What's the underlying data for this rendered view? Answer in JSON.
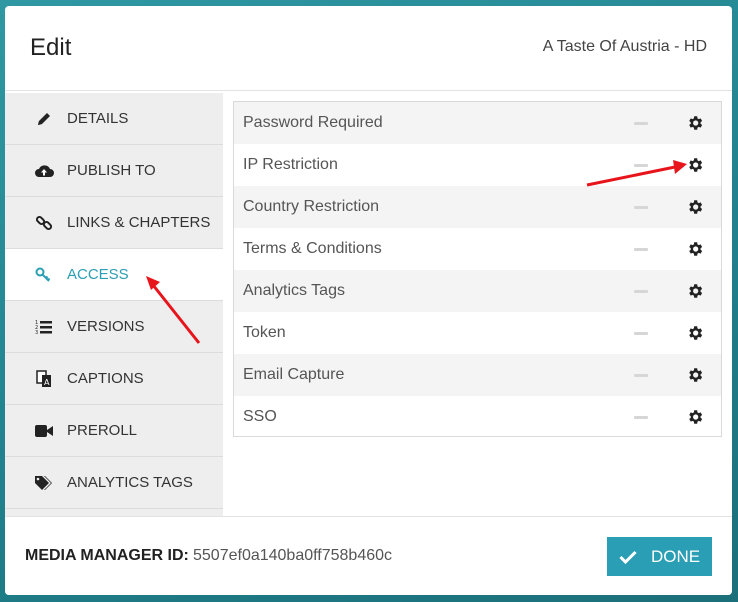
{
  "modal": {
    "title": "Edit",
    "subtitle": "A Taste Of Austria - HD"
  },
  "sidebar": {
    "items": [
      {
        "label": "DETAILS",
        "icon": "pencil-icon"
      },
      {
        "label": "PUBLISH TO",
        "icon": "cloud-upload-icon"
      },
      {
        "label": "LINKS & CHAPTERS",
        "icon": "link-icon"
      },
      {
        "label": "ACCESS",
        "icon": "key-icon",
        "active": true
      },
      {
        "label": "VERSIONS",
        "icon": "numbered-list-icon"
      },
      {
        "label": "CAPTIONS",
        "icon": "translate-icon"
      },
      {
        "label": "PREROLL",
        "icon": "video-camera-icon"
      },
      {
        "label": "ANALYTICS TAGS",
        "icon": "tags-icon"
      }
    ]
  },
  "access": {
    "rows": [
      {
        "label": "Password Required"
      },
      {
        "label": "IP Restriction"
      },
      {
        "label": "Country Restriction"
      },
      {
        "label": "Terms & Conditions"
      },
      {
        "label": "Analytics Tags"
      },
      {
        "label": "Token"
      },
      {
        "label": "Email Capture"
      },
      {
        "label": "SSO"
      }
    ]
  },
  "footer": {
    "media_manager_label": "MEDIA MANAGER ID:",
    "media_manager_id": "5507ef0a140ba0ff758b460c",
    "done_label": "DONE"
  },
  "colors": {
    "accent": "#2a9eb4",
    "annotation_arrow": "#e8141b"
  }
}
